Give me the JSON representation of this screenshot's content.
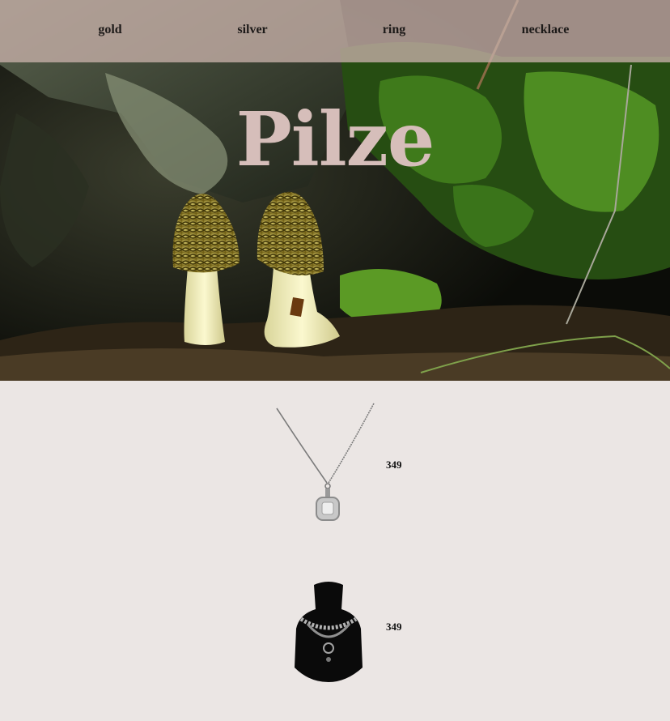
{
  "nav": {
    "items": [
      {
        "label": "gold"
      },
      {
        "label": "silver"
      },
      {
        "label": "ring"
      },
      {
        "label": "necklace"
      }
    ]
  },
  "hero": {
    "title": "Pilze",
    "image": "mushrooms-on-mossy-forest-floor"
  },
  "products": [
    {
      "image": "pendant-necklace-icon",
      "price": "349"
    },
    {
      "image": "bust-necklace-icon",
      "price": "349"
    }
  ],
  "colors": {
    "page_background": "#ebe6e4",
    "nav_background": "#c4aea6",
    "title": "#d6beba",
    "text": "#1d1a19"
  }
}
